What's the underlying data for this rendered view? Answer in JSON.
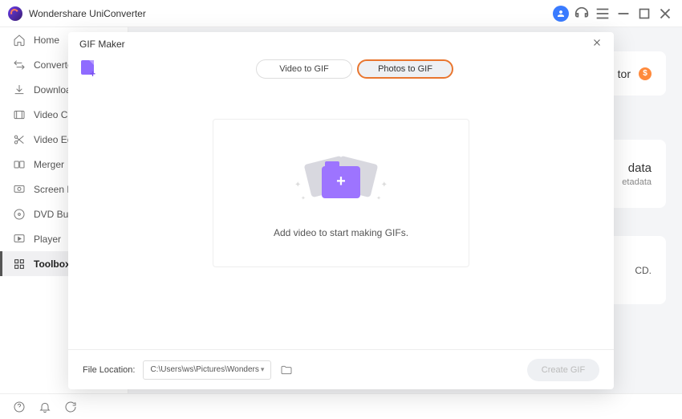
{
  "titlebar": {
    "app_name": "Wondershare UniConverter"
  },
  "sidebar": {
    "items": [
      {
        "label": "Home"
      },
      {
        "label": "Converter"
      },
      {
        "label": "Downloader"
      },
      {
        "label": "Video Compressor"
      },
      {
        "label": "Video Editor"
      },
      {
        "label": "Merger"
      },
      {
        "label": "Screen Recorder"
      },
      {
        "label": "DVD Burner"
      },
      {
        "label": "Player"
      },
      {
        "label": "Toolbox"
      }
    ]
  },
  "bg_cards": {
    "card1_label": "tor",
    "card2_title": "data",
    "card2_sub": "etadata",
    "card3_text": "CD."
  },
  "modal": {
    "title": "GIF Maker",
    "tabs": {
      "video": "Video to GIF",
      "photos": "Photos to GIF"
    },
    "drop_text": "Add video to start making GIFs.",
    "footer": {
      "label": "File Location:",
      "path": "C:\\Users\\ws\\Pictures\\Wonders",
      "create_btn": "Create GIF"
    }
  }
}
